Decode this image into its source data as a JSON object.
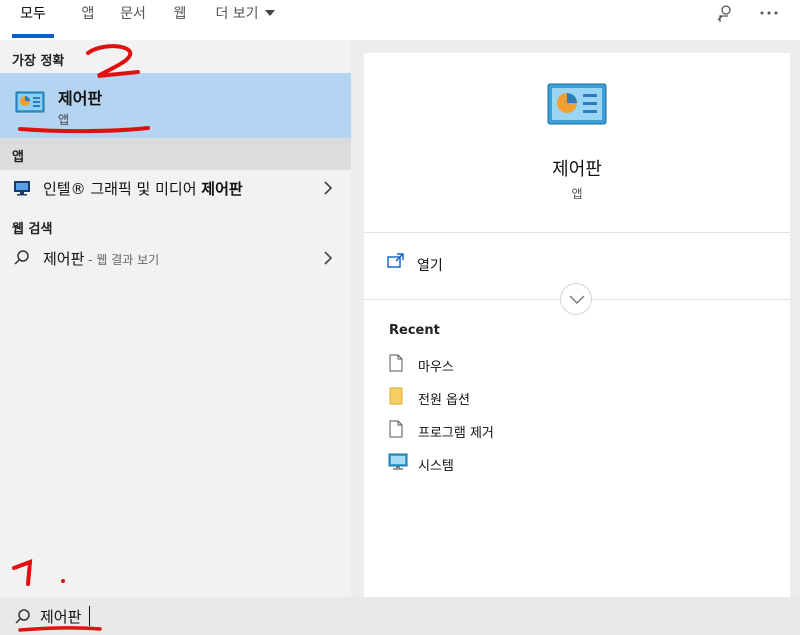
{
  "tabs": [
    {
      "label": "모두",
      "active": true
    },
    {
      "label": "앱",
      "active": false
    },
    {
      "label": "문서",
      "active": false
    },
    {
      "label": "웹",
      "active": false
    },
    {
      "label": "더 보기",
      "active": false
    }
  ],
  "top_icons": [
    "feedback-icon",
    "more-options-icon"
  ],
  "left_panel": {
    "best_match_header": "가장 정확",
    "best_match": {
      "title": "제어판",
      "subtitle": "앱",
      "icon": "control-panel-icon"
    },
    "apps_header": "앱",
    "apps": [
      {
        "prefix": "인텔® 그래픽 및 미디어 ",
        "bold": "제어판",
        "icon": "intel-graphics-icon"
      }
    ],
    "web_header": "웹 검색",
    "web": [
      {
        "query": "제어판",
        "suffix": " - 웹 결과 보기",
        "icon": "search-icon"
      }
    ]
  },
  "preview": {
    "title": "제어판",
    "subtitle": "앱",
    "icon": "control-panel-icon",
    "open_label": "열기",
    "recent_header": "Recent",
    "recent": [
      {
        "label": "마우스",
        "icon": "document-icon"
      },
      {
        "label": "전원 옵션",
        "icon": "folder-icon"
      },
      {
        "label": "프로그램 제거",
        "icon": "document-icon"
      },
      {
        "label": "시스템",
        "icon": "monitor-icon"
      }
    ]
  },
  "search": {
    "value": "제어판"
  },
  "annotations": {
    "color": "#e01010",
    "labels": [
      "1.",
      "2"
    ]
  },
  "colors": {
    "accent": "#0a62c9",
    "selection": "#b4d5f1"
  }
}
